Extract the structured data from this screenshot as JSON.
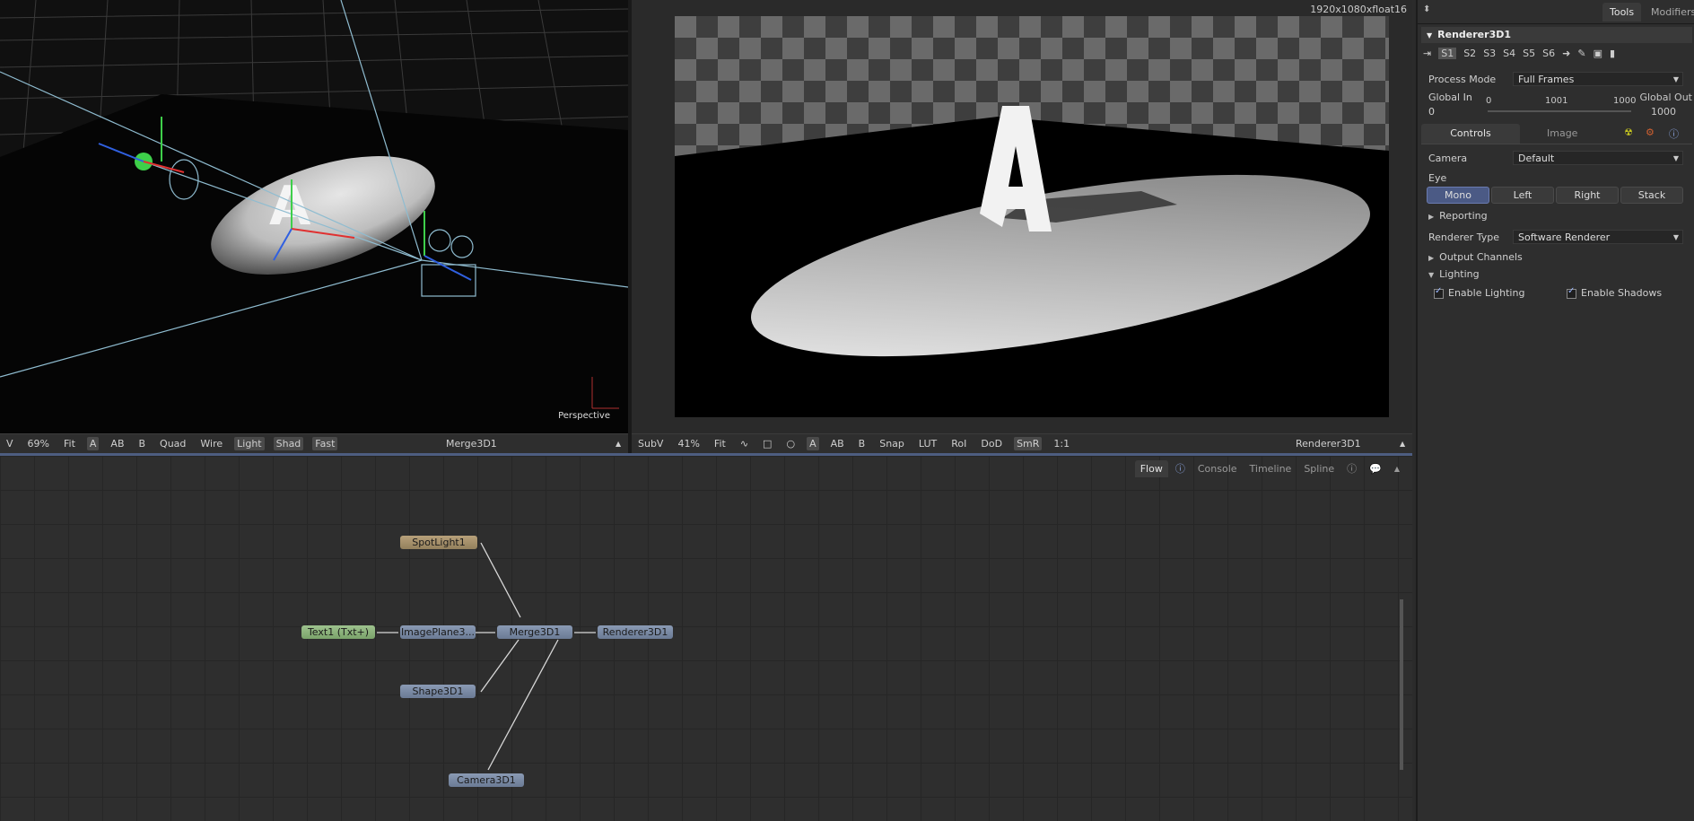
{
  "viewer_left": {
    "label": "Perspective",
    "toolbar": [
      "V",
      "69%",
      "Fit",
      "A",
      "AB",
      "B",
      "Quad",
      "Wire",
      "Light",
      "Shad",
      "Fast"
    ],
    "title": "Merge3D1"
  },
  "viewer_right": {
    "resolution": "1920x1080xfloat16",
    "toolbar": [
      "SubV",
      "41%",
      "Fit",
      "A",
      "AB",
      "B",
      "Snap",
      "LUT",
      "RoI",
      "DoD",
      "SmR",
      "1:1"
    ],
    "title": "Renderer3D1"
  },
  "flow": {
    "tabs": [
      "Flow",
      "Console",
      "Timeline",
      "Spline"
    ],
    "nodes": [
      {
        "name": "SpotLight1"
      },
      {
        "name": "Text1 (Txt+)"
      },
      {
        "name": "ImagePlane3..."
      },
      {
        "name": "Merge3D1"
      },
      {
        "name": "Renderer3D1"
      },
      {
        "name": "Shape3D1"
      },
      {
        "name": "Camera3D1"
      }
    ]
  },
  "panel": {
    "tabs": [
      "Tools",
      "Modifiers"
    ],
    "tool_name": "Renderer3D1",
    "slots": [
      "S1",
      "S2",
      "S3",
      "S4",
      "S5",
      "S6"
    ],
    "process_mode_label": "Process Mode",
    "process_mode_value": "Full Frames",
    "global_in_label": "Global In",
    "global_out_label": "Global Out",
    "global_in_value": "0",
    "global_out_value": "1000",
    "range_start": "0",
    "range_mid": "1001",
    "range_end": "1000",
    "subtabs": [
      "Controls",
      "Image"
    ],
    "camera_label": "Camera",
    "camera_value": "Default",
    "eye_label": "Eye",
    "eye_options": [
      "Mono",
      "Left",
      "Right",
      "Stack"
    ],
    "reporting_label": "Reporting",
    "renderer_type_label": "Renderer Type",
    "renderer_type_value": "Software Renderer",
    "output_channels_label": "Output Channels",
    "lighting_label": "Lighting",
    "enable_lighting_label": "Enable Lighting",
    "enable_shadows_label": "Enable Shadows"
  }
}
